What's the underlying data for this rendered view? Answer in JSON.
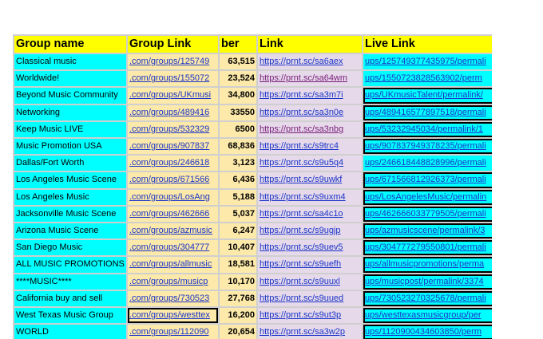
{
  "headers": [
    "Group name",
    "Group Link",
    "ber",
    "Link",
    "Live Link"
  ],
  "rows": [
    {
      "name": "Classical music",
      "group_link": ".com/groups/125749",
      "members": "63,515",
      "link": "https://prnt.sc/sa6aex",
      "live": "ups/125749377435975/permali",
      "link_visited": false,
      "live_boxed": false,
      "glink_boxed": false
    },
    {
      "name": "Worldwide!",
      "group_link": ".com/groups/155072",
      "members": "23,524",
      "link": "https://prnt.sc/sa64wm",
      "live": "ups/1550723828563902/perm",
      "link_visited": true,
      "live_boxed": false,
      "glink_boxed": false
    },
    {
      "name": "Beyond Music Community",
      "group_link": ".com/groups/UKmusi",
      "members": "34,800",
      "link": "https://prnt.sc/sa3m7i",
      "live": "ups/UKmusicTalent/permalink/",
      "link_visited": false,
      "live_boxed": true,
      "glink_boxed": false
    },
    {
      "name": "Networking",
      "group_link": ".com/groups/489416",
      "members": "33550",
      "link": "https://prnt.sc/sa3n0e",
      "live": "ups/489416577897518/permali",
      "link_visited": false,
      "live_boxed": true,
      "glink_boxed": false
    },
    {
      "name": "Keep Music LIVE",
      "group_link": ".com/groups/532329",
      "members": "6500",
      "link": "https://prnt.sc/sa3nbg",
      "live": "ups/53232945034/permalink/1",
      "link_visited": true,
      "live_boxed": true,
      "glink_boxed": false
    },
    {
      "name": "Music Promotion USA",
      "group_link": ".com/groups/907837",
      "members": "68,836",
      "link": "https://prnt.sc/s9trc4",
      "live": "ups/907837949378235/permali",
      "link_visited": false,
      "live_boxed": true,
      "glink_boxed": false
    },
    {
      "name": "Dallas/Fort Worth",
      "group_link": ".com/groups/246618",
      "members": "3,123",
      "link": "https://prnt.sc/s9u5q4",
      "live": "ups/246618448828996/permali",
      "link_visited": false,
      "live_boxed": false,
      "glink_boxed": false
    },
    {
      "name": "Los Angeles Music Scene",
      "group_link": ".com/groups/671566",
      "members": "6,436",
      "link": "https://prnt.sc/s9uwkf",
      "live": "ups/671566812926373/permali",
      "link_visited": false,
      "live_boxed": true,
      "glink_boxed": false
    },
    {
      "name": "Los Angeles Music",
      "group_link": ".com/groups/LosAng",
      "members": "5,188",
      "link": "https://prnt.sc/s9uxm4",
      "live": "ups/LosAngelesMusic/permalin",
      "link_visited": false,
      "live_boxed": true,
      "glink_boxed": false
    },
    {
      "name": "Jacksonville Music Scene",
      "group_link": ".com/groups/462666",
      "members": "5,037",
      "link": "https://prnt.sc/sa4c1o",
      "live": "ups/462666033779505/permali",
      "link_visited": false,
      "live_boxed": true,
      "glink_boxed": false
    },
    {
      "name": "Arizona Music Scene",
      "group_link": ".com/groups/azmusic",
      "members": "6,247",
      "link": "https://prnt.sc/s9ugjp",
      "live": "ups/azmusicscene/permalink/3",
      "link_visited": false,
      "live_boxed": true,
      "glink_boxed": false
    },
    {
      "name": "San Diego Music",
      "group_link": ".com/groups/304777",
      "members": "10,407",
      "link": "https://prnt.sc/s9uev5",
      "live": "ups/304777279550801/permali",
      "link_visited": false,
      "live_boxed": true,
      "glink_boxed": false
    },
    {
      "name": "ALL MUSIC PROMOTIONS",
      "group_link": ".com/groups/allmusic",
      "members": "18,581",
      "link": "https://prnt.sc/s9uefh",
      "live": "ups/allmusicpromotions/perma",
      "link_visited": false,
      "live_boxed": true,
      "glink_boxed": false
    },
    {
      "name": "****MUSIC****",
      "group_link": ".com/groups/musicp",
      "members": "10,170",
      "link": "https://prnt.sc/s9uuxl",
      "live": "ups/musicpost/permalink/3374",
      "link_visited": false,
      "live_boxed": true,
      "glink_boxed": false
    },
    {
      "name": "California buy and sell",
      "group_link": ".com/groups/730523",
      "members": "27,768",
      "link": "https://prnt.sc/s9uued",
      "live": "ups/730523270325678/permali",
      "link_visited": false,
      "live_boxed": true,
      "glink_boxed": false
    },
    {
      "name": "West Texas Music Group",
      "group_link": ".com/groups/westtex",
      "members": "16,200",
      "link": "https://prnt.sc/s9ut3p",
      "live": "ups/westtexasmusicgroup/per",
      "link_visited": false,
      "live_boxed": true,
      "glink_boxed": true
    },
    {
      "name": "WORLD",
      "group_link": ".com/groups/112090",
      "members": "20,654",
      "link": "https://prnt.sc/sa3w2p",
      "live": "ups/1120900434603850/perm",
      "link_visited": false,
      "live_boxed": true,
      "glink_boxed": false
    }
  ]
}
